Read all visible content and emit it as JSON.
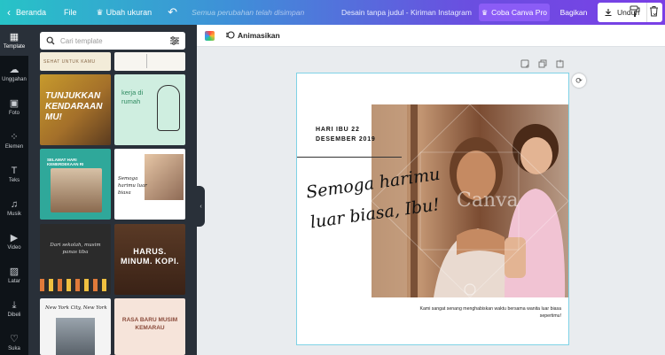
{
  "topbar": {
    "back_label": "Beranda",
    "file_label": "File",
    "resize_label": "Ubah ukuran",
    "saved_status": "Semua perubahan telah disimpan",
    "doc_title": "Desain tanpa judul - Kiriman Instagram",
    "pro_label": "Coba Canva Pro",
    "share_label": "Bagikan",
    "download_label": "Unduh"
  },
  "rail": {
    "items": [
      {
        "label": "Template",
        "icon": "template-icon"
      },
      {
        "label": "Unggahan",
        "icon": "upload-icon"
      },
      {
        "label": "Foto",
        "icon": "photo-icon"
      },
      {
        "label": "Elemen",
        "icon": "elements-icon"
      },
      {
        "label": "Teks",
        "icon": "text-icon"
      },
      {
        "label": "Musik",
        "icon": "music-icon"
      },
      {
        "label": "Video",
        "icon": "video-icon"
      },
      {
        "label": "Latar",
        "icon": "background-icon"
      },
      {
        "label": "Dibeli",
        "icon": "purchased-icon"
      },
      {
        "label": "Suka",
        "icon": "heart-icon"
      }
    ]
  },
  "panel": {
    "search_placeholder": "Cari template",
    "templates": [
      {
        "text": "SEHAT UNTUK KAMU"
      },
      {
        "text": ""
      },
      {
        "text": "TUNJUKKAN KENDARAAN MU!"
      },
      {
        "text": "kerja di rumah"
      },
      {
        "text": "SELAMAT HARI KEMERDEKAAN RI"
      },
      {
        "text": "Semoga harimu luar biasa"
      },
      {
        "text": "Dari sekolah, musim panas tiba"
      },
      {
        "text": "HARUS. MINUM. KOPI."
      },
      {
        "text": "New York City, New York"
      },
      {
        "text": "RASA BARU MUSIM KEMARAU"
      }
    ]
  },
  "toolbar": {
    "animate_label": "Animasikan"
  },
  "design": {
    "date_line1": "HARI IBU 22",
    "date_line2": "DESEMBER 2019",
    "script_text": "Semoga harimu luar biasa, Ibu!",
    "caption_line1": "Kami sangat senang menghabiskan waktu bersama wanita luar biasa",
    "caption_line2": "sepertimu!",
    "watermark": "Canva"
  },
  "colors": {
    "rail_bg": "#0e1318",
    "panel_bg": "#293039",
    "pro_button": "#8b5cf6",
    "page_outline": "#7fd2e6"
  }
}
